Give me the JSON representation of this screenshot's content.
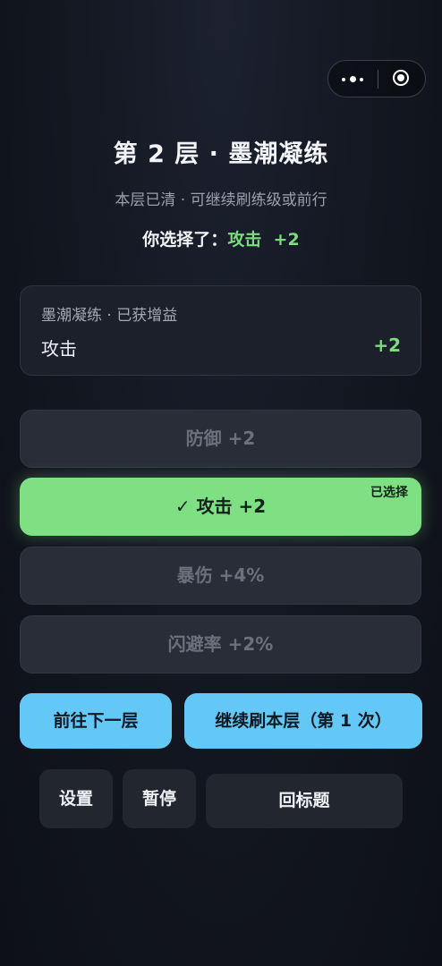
{
  "capsule": {
    "more_icon": "more-dots-icon",
    "close_icon": "target-circle-icon"
  },
  "header": {
    "title": "第 2 层 · 墨潮凝练",
    "subtitle": "本层已清 · 可继续刷练级或前行",
    "chosen_prefix": "你选择了：",
    "chosen_value": "攻击  +2"
  },
  "buff_panel": {
    "label": "墨潮凝练 · 已获增益",
    "stat_name": "攻击",
    "stat_value": "+2"
  },
  "options": [
    {
      "label": "防御 +2",
      "selected": false
    },
    {
      "label": "✓ 攻击 +2",
      "selected": true,
      "tag": "已选择"
    },
    {
      "label": "暴伤 +4%",
      "selected": false
    },
    {
      "label": "闪避率 +2%",
      "selected": false
    }
  ],
  "actions": {
    "next_floor": "前往下一层",
    "repeat_floor": "继续刷本层（第 1 次）",
    "settings": "设置",
    "pause": "暂停",
    "back_to_title": "回标题"
  },
  "colors": {
    "accent_green": "#7fe083",
    "accent_blue": "#64c8f7"
  }
}
